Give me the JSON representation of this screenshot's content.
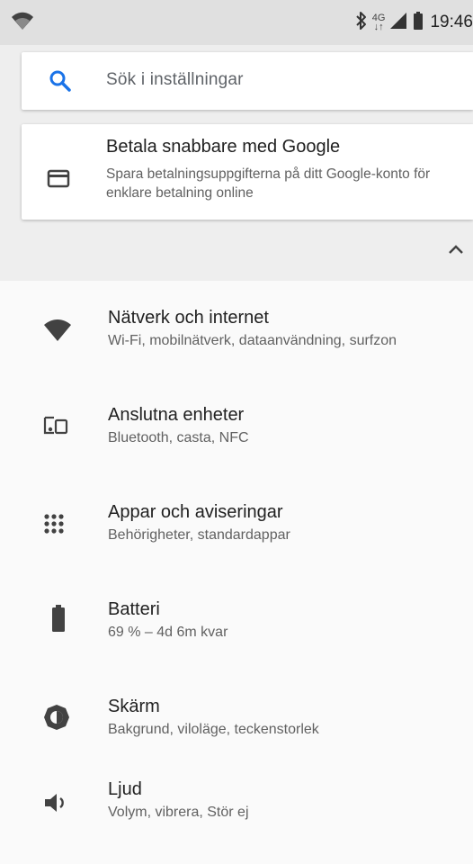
{
  "status_bar": {
    "network_type": "4G",
    "time": "19:46",
    "icons": [
      "wifi-icon",
      "bluetooth-icon",
      "signal-icon",
      "battery-icon"
    ]
  },
  "search": {
    "placeholder": "Sök i inställningar",
    "icon": "search-icon"
  },
  "suggestion": {
    "title": "Betala snabbare med Google",
    "subtitle": "Spara betalningsuppgifterna på ditt Google-konto för enklare betalning online",
    "icon": "credit-card-icon"
  },
  "collapse_icon": "chevron-up-icon",
  "settings": [
    {
      "title": "Nätverk och internet",
      "subtitle": "Wi-Fi, mobilnätverk, dataanvändning, surfzon",
      "icon": "wifi-icon"
    },
    {
      "title": "Anslutna enheter",
      "subtitle": "Bluetooth, casta, NFC",
      "icon": "devices-icon"
    },
    {
      "title": "Appar och aviseringar",
      "subtitle": "Behörigheter, standardappar",
      "icon": "apps-grid-icon"
    },
    {
      "title": "Batteri",
      "subtitle": "69 % – 4d 6m kvar",
      "icon": "battery-icon"
    },
    {
      "title": "Skärm",
      "subtitle": "Bakgrund, viloläge, teckenstorlek",
      "icon": "brightness-icon"
    },
    {
      "title": "Ljud",
      "subtitle": "Volym, vibrera, Stör ej",
      "icon": "volume-icon"
    }
  ],
  "colors": {
    "accent": "#1a73e8",
    "icon_gray": "#5f6368",
    "status_bar_bg": "#e0e0e0",
    "header_bg": "#eeeeee"
  }
}
